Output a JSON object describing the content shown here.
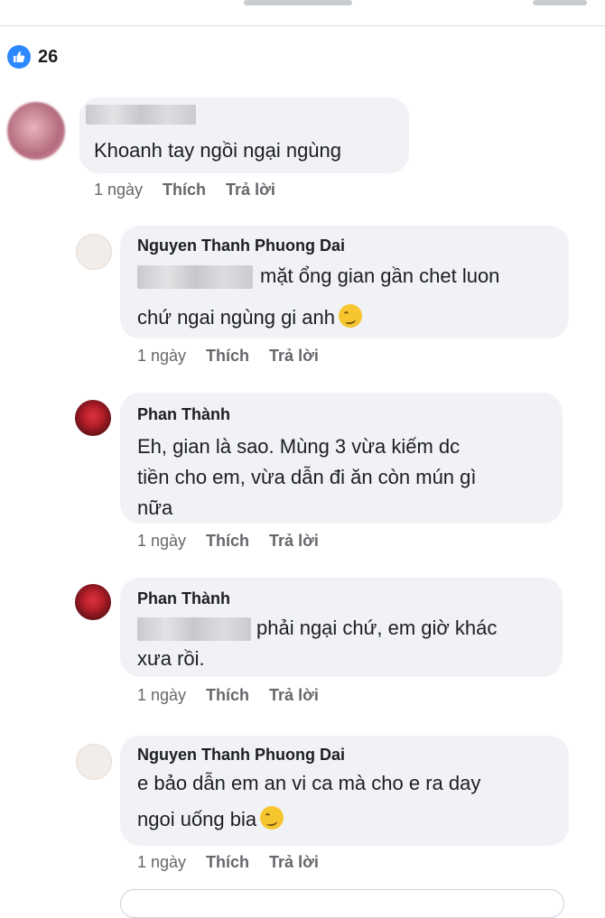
{
  "reactions": {
    "count": "26",
    "icon": "like-icon",
    "color": "#2d88ff"
  },
  "comments": [
    {
      "author": "",
      "avatar": "blurred-avatar",
      "lines": [
        "Khoanh tay ngồi ngại ngùng"
      ],
      "time": "1 ngày",
      "like": "Thích",
      "reply": "Trả lời"
    },
    {
      "author": "Nguyen Thanh Phuong Dai",
      "avatar": "woman-avatar",
      "lines": [
        "mặt ổng gian gần chet luon",
        "chứ ngai ngùng gi anh"
      ],
      "time": "1 ngày",
      "like": "Thích",
      "reply": "Trả lời"
    },
    {
      "author": "Phan Thành",
      "avatar": "red-avatar",
      "lines": [
        "Eh, gian là sao. Mùng 3 vừa kiếm dc",
        "tiền cho em, vừa dẫn đi ăn còn mún gì",
        "nữa"
      ],
      "time": "1 ngày",
      "like": "Thích",
      "reply": "Trả lời"
    },
    {
      "author": "Phan Thành",
      "avatar": "red-avatar",
      "lines": [
        "phải ngại chứ, em giờ khác",
        "xưa rồi."
      ],
      "time": "1 ngày",
      "like": "Thích",
      "reply": "Trả lời"
    },
    {
      "author": "Nguyen Thanh Phuong Dai",
      "avatar": "woman-avatar",
      "lines": [
        "e bảo dẫn em an vi ca mà cho e ra day",
        "ngoi uống bia"
      ],
      "time": "1 ngày",
      "like": "Thích",
      "reply": "Trả lời"
    }
  ]
}
